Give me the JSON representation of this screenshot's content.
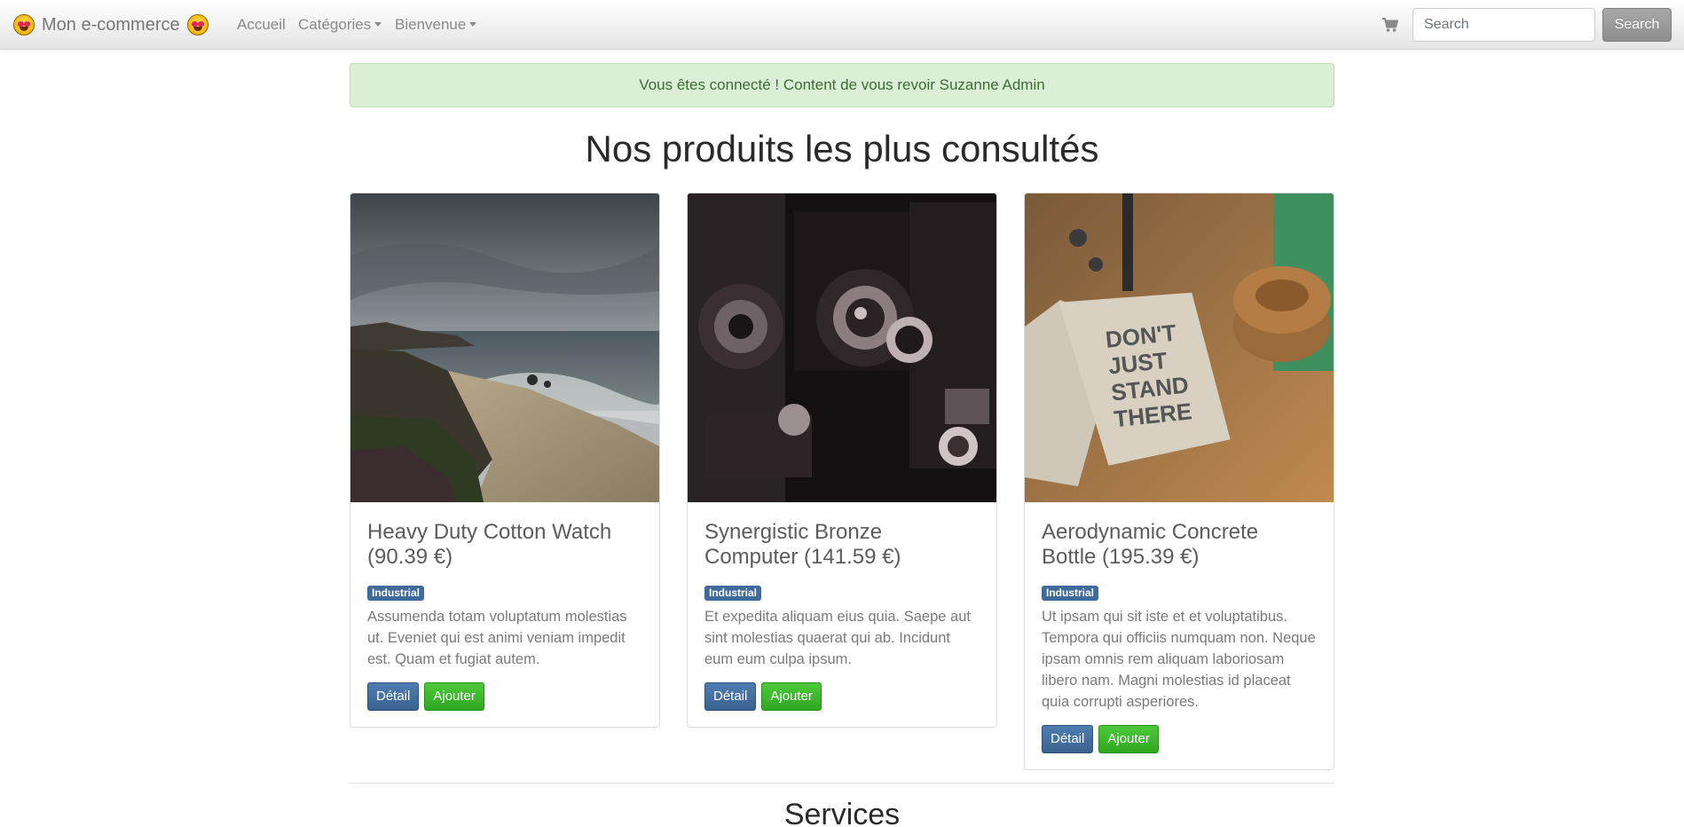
{
  "navbar": {
    "brand": "Mon e-commerce",
    "links": [
      {
        "label": "Accueil"
      },
      {
        "label": "Catégories"
      },
      {
        "label": "Bienvenue"
      }
    ],
    "search": {
      "placeholder": "Search",
      "value": "",
      "button_label": "Search"
    }
  },
  "alert": {
    "message": "Vous êtes connecté ! Content de vous revoir Suzanne Admin"
  },
  "main": {
    "title": "Nos produits les plus consultés",
    "products": [
      {
        "name": "Heavy Duty Cotton Watch",
        "price": "(90.39 €)",
        "category": "Industrial",
        "description": "Assumenda totam voluptatum molestias ut. Eveniet qui est animi veniam impedit est. Quam et fugiat autem.",
        "detail_label": "Détail",
        "add_label": "Ajouter"
      },
      {
        "name": "Synergistic Bronze Computer",
        "price": "(141.59 €)",
        "category": "Industrial",
        "description": "Et expedita aliquam eius quia. Saepe aut sint molestias quaerat qui ab. Incidunt eum eum culpa ipsum.",
        "detail_label": "Détail",
        "add_label": "Ajouter"
      },
      {
        "name": "Aerodynamic Concrete Bottle",
        "price": "(195.39 €)",
        "category": "Industrial",
        "description": "Ut ipsam qui sit iste et et voluptatibus. Tempora qui officiis numquam non. Neque ipsam omnis rem aliquam laboriosam libero nam. Magni molestias id placeat quia corrupti asperiores.",
        "detail_label": "Détail",
        "add_label": "Ajouter"
      }
    ],
    "services_title": "Services"
  },
  "colors": {
    "alert_bg": "#dbefd6",
    "alert_text": "#3c6b35",
    "badge": "#3f6a9b",
    "detail_button": "#3a6290",
    "add_button": "#30a822"
  }
}
